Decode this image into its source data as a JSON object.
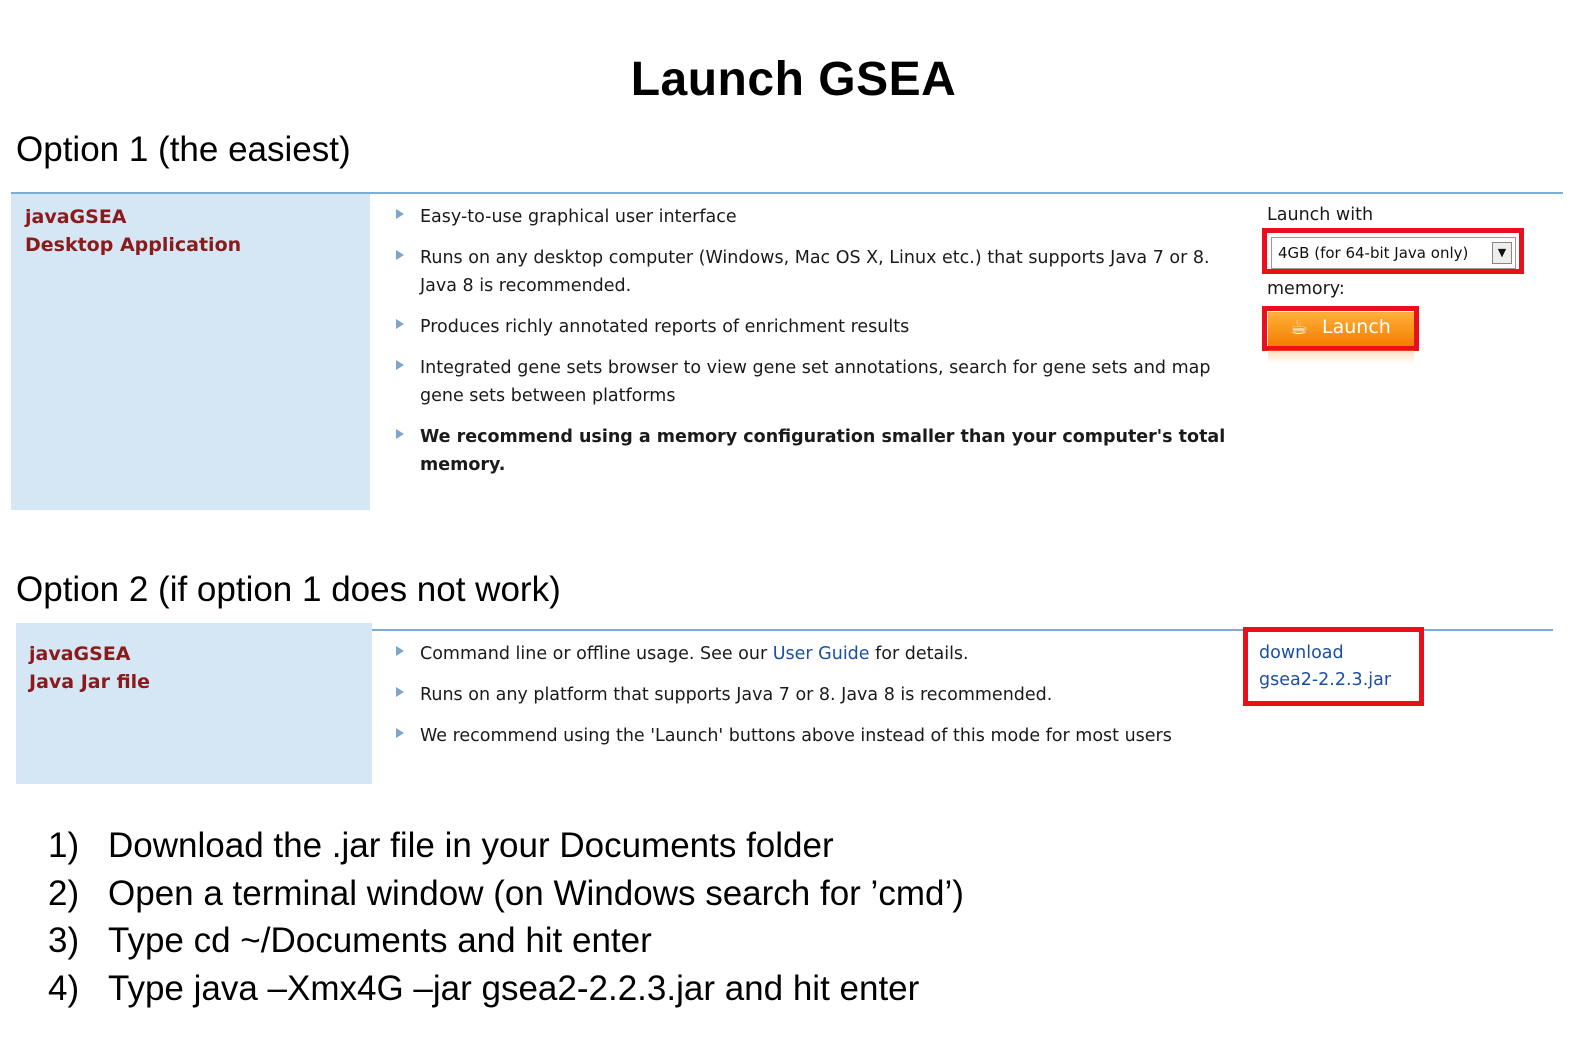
{
  "title": "Launch GSEA",
  "option1": {
    "heading": "Option 1 (the easiest)",
    "side_label_line1": "javaGSEA",
    "side_label_line2": "Desktop Application",
    "bullets": [
      "Easy-to-use graphical user interface",
      "Runs on any desktop computer (Windows, Mac OS X, Linux etc.) that supports Java 7 or 8. Java 8 is recommended.",
      "Produces richly annotated reports of enrichment results",
      "Integrated gene sets browser to view gene set annotations, search for gene sets and map gene sets between platforms",
      "We recommend using a memory configuration smaller than your computer's total memory."
    ],
    "launch_with_label": "Launch with",
    "memory_label": "memory:",
    "memory_select_value": "4GB  (for 64-bit Java only)",
    "launch_button_label": "Launch",
    "launch_icon": "java-cup-icon"
  },
  "option2": {
    "heading": "Option 2 (if option 1 does not work)",
    "side_label_line1": "javaGSEA",
    "side_label_line2": "Java Jar file",
    "bullet1_prefix": "Command line or offline usage. See our ",
    "bullet1_link": "User Guide",
    "bullet1_suffix": " for details.",
    "bullet2": "Runs on any platform that supports Java 7 or 8. Java 8 is recommended.",
    "bullet3": "We recommend using the 'Launch' buttons above instead of this mode for most users",
    "download_line1": "download",
    "download_line2": "gsea2-2.2.3.jar"
  },
  "steps": [
    {
      "num": "1)",
      "text": "Download the .jar file in your Documents folder"
    },
    {
      "num": "2)",
      "text": "Open a terminal window (on Windows search for ’cmd’)"
    },
    {
      "num": "3)",
      "text": "Type cd  ~/Documents and hit enter"
    },
    {
      "num": "4)",
      "text": "Type java –Xmx4G –jar gsea2-2.2.3.jar and hit enter"
    }
  ],
  "colors": {
    "side_cell_bg": "#d5e6f5",
    "side_text": "#8b1a1a",
    "highlight_box": "#e8101a",
    "launch_button": "#f47d00",
    "link": "#1b4fa3"
  }
}
